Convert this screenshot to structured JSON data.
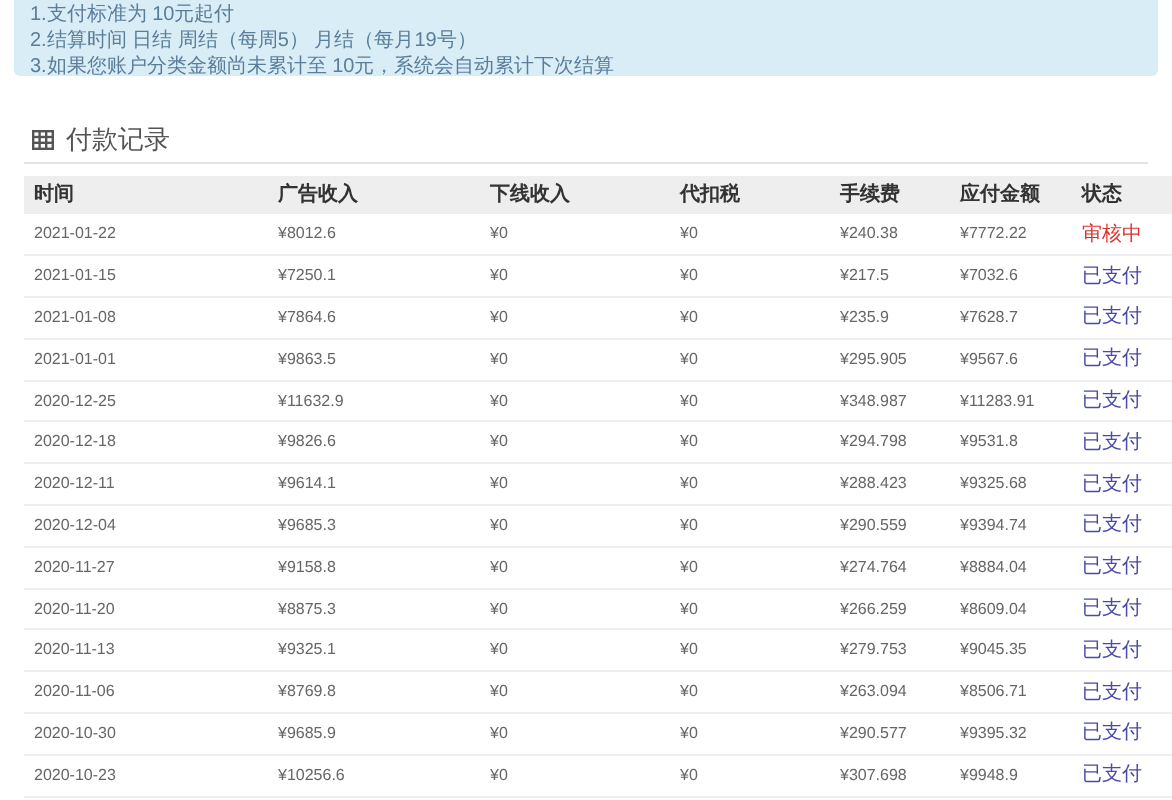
{
  "notice": {
    "lines": [
      "1.支付标准为 10元起付",
      "2.结算时间 日结 周结（每周5） 月结（每月19号）",
      "3.如果您账户分类金额尚未累计至 10元，系统会自动累计下次结算"
    ]
  },
  "section": {
    "title": "付款记录"
  },
  "table": {
    "columns": [
      "时间",
      "广告收入",
      "下线收入",
      "代扣税",
      "手续费",
      "应付金额",
      "状态"
    ],
    "rows": [
      {
        "cells": [
          "2021-01-22",
          "¥8012.6",
          "¥0",
          "¥0",
          "¥240.38",
          "¥7772.22"
        ],
        "status": {
          "text": "审核中",
          "color": "#d9322e"
        }
      },
      {
        "cells": [
          "2021-01-15",
          "¥7250.1",
          "¥0",
          "¥0",
          "¥217.5",
          "¥7032.6"
        ],
        "status": {
          "text": "已支付",
          "color": "#4a4aa8"
        }
      },
      {
        "cells": [
          "2021-01-08",
          "¥7864.6",
          "¥0",
          "¥0",
          "¥235.9",
          "¥7628.7"
        ],
        "status": {
          "text": "已支付",
          "color": "#4a4aa8"
        }
      },
      {
        "cells": [
          "2021-01-01",
          "¥9863.5",
          "¥0",
          "¥0",
          "¥295.905",
          "¥9567.6"
        ],
        "status": {
          "text": "已支付",
          "color": "#4a4aa8"
        }
      },
      {
        "cells": [
          "2020-12-25",
          "¥11632.9",
          "¥0",
          "¥0",
          "¥348.987",
          "¥11283.91"
        ],
        "status": {
          "text": "已支付",
          "color": "#4a4aa8"
        }
      },
      {
        "cells": [
          "2020-12-18",
          "¥9826.6",
          "¥0",
          "¥0",
          "¥294.798",
          "¥9531.8"
        ],
        "status": {
          "text": "已支付",
          "color": "#4a4aa8"
        }
      },
      {
        "cells": [
          "2020-12-11",
          "¥9614.1",
          "¥0",
          "¥0",
          "¥288.423",
          "¥9325.68"
        ],
        "status": {
          "text": "已支付",
          "color": "#4a4aa8"
        }
      },
      {
        "cells": [
          "2020-12-04",
          "¥9685.3",
          "¥0",
          "¥0",
          "¥290.559",
          "¥9394.74"
        ],
        "status": {
          "text": "已支付",
          "color": "#4a4aa8"
        }
      },
      {
        "cells": [
          "2020-11-27",
          "¥9158.8",
          "¥0",
          "¥0",
          "¥274.764",
          "¥8884.04"
        ],
        "status": {
          "text": "已支付",
          "color": "#4a4aa8"
        }
      },
      {
        "cells": [
          "2020-11-20",
          "¥8875.3",
          "¥0",
          "¥0",
          "¥266.259",
          "¥8609.04"
        ],
        "status": {
          "text": "已支付",
          "color": "#4a4aa8"
        }
      },
      {
        "cells": [
          "2020-11-13",
          "¥9325.1",
          "¥0",
          "¥0",
          "¥279.753",
          "¥9045.35"
        ],
        "status": {
          "text": "已支付",
          "color": "#4a4aa8"
        }
      },
      {
        "cells": [
          "2020-11-06",
          "¥8769.8",
          "¥0",
          "¥0",
          "¥263.094",
          "¥8506.71"
        ],
        "status": {
          "text": "已支付",
          "color": "#4a4aa8"
        }
      },
      {
        "cells": [
          "2020-10-30",
          "¥9685.9",
          "¥0",
          "¥0",
          "¥290.577",
          "¥9395.32"
        ],
        "status": {
          "text": "已支付",
          "color": "#4a4aa8"
        }
      },
      {
        "cells": [
          "2020-10-23",
          "¥10256.6",
          "¥0",
          "¥0",
          "¥307.698",
          "¥9948.9"
        ],
        "status": {
          "text": "已支付",
          "color": "#4a4aa8"
        }
      }
    ]
  }
}
